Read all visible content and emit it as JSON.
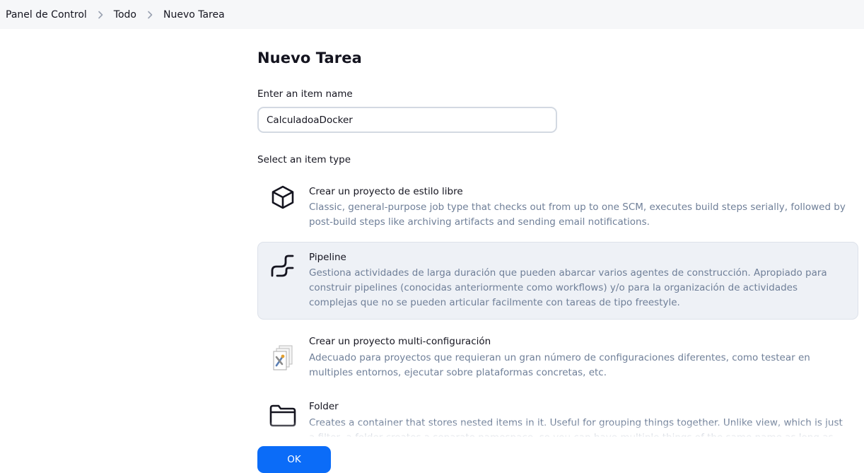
{
  "breadcrumb": {
    "items": [
      "Panel de Control",
      "Todo",
      "Nuevo Tarea"
    ]
  },
  "page_title": "Nuevo Tarea",
  "name_field": {
    "label": "Enter an item name",
    "value": "CalculadoaDocker"
  },
  "type_section": {
    "label": "Select an item type",
    "items": [
      {
        "icon": "freestyle-cube-icon",
        "title": "Crear un proyecto de estilo libre",
        "description": "Classic, general-purpose job type that checks out from up to one SCM, executes build steps serially, followed by post-build steps like archiving artifacts and sending email notifications."
      },
      {
        "icon": "pipeline-icon",
        "title": "Pipeline",
        "description": "Gestiona actividades de larga duración que pueden abarcar varios agentes de construcción. Apropiado para construir pipelines (conocidas anteriormente como workflows) y/o para la organización de actividades complejas que no se pueden articular facilmente con tareas de tipo freestyle.",
        "selected": true
      },
      {
        "icon": "multi-configuration-icon",
        "title": "Crear un proyecto multi-configuración",
        "description": "Adecuado para proyectos que requieran un gran número de configuraciones diferentes, como testear en multiples entornos, ejecutar sobre plataformas concretas, etc."
      },
      {
        "icon": "folder-icon",
        "title": "Folder",
        "description": "Creates a container that stores nested items in it. Useful for grouping things together. Unlike view, which is just a filter, a folder creates a separate namespace, so you can have multiple things of the same name as long as they are in different"
      }
    ]
  },
  "ok_button": "OK",
  "colors": {
    "accent": "#0b6cf8",
    "selected_bg": "#eef1f6",
    "muted_text": "#6f7f98"
  }
}
